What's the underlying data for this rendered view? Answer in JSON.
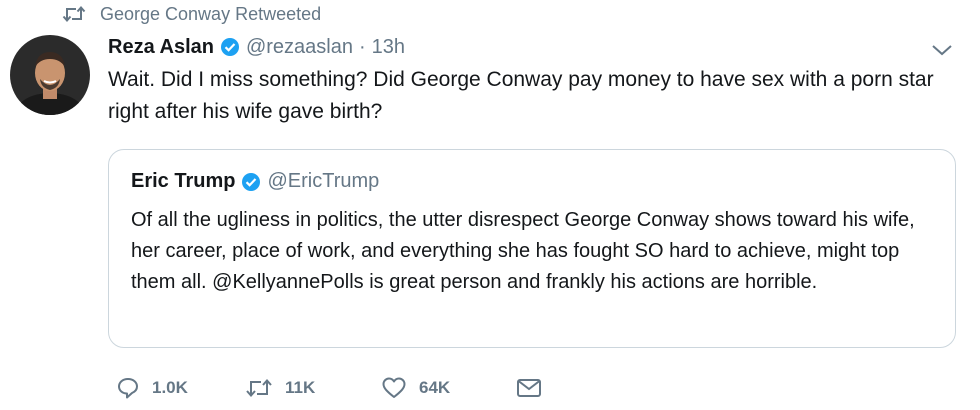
{
  "retweet_context": {
    "label": "George Conway Retweeted",
    "icon": "retweet-icon"
  },
  "tweet": {
    "author_name": "Reza Aslan",
    "verified_icon": "verified-badge-icon",
    "handle": "@rezaaslan",
    "separator": "·",
    "time": "13h",
    "text": "Wait. Did I miss something? Did George Conway pay money to have sex with a porn star right after his wife gave birth?",
    "menu_icon": "chevron-down-icon"
  },
  "quoted_tweet": {
    "author_name": "Eric Trump",
    "handle": "@EricTrump",
    "text": "Of all the ugliness in politics, the utter disrespect George Conway shows toward his wife, her career, place of work, and everything she has fought SO hard to achieve, might top them all. @KellyannePolls is great person and frankly his actions are horrible."
  },
  "actions": {
    "reply_count": "1.0K",
    "retweet_count": "11K",
    "like_count": "64K",
    "icons": [
      "reply-icon",
      "retweet-icon",
      "like-icon",
      "direct-message-icon"
    ]
  },
  "colors": {
    "verified": "#1da1f2",
    "secondary_text": "#657786",
    "border": "#ccd6dd",
    "primary_text": "#14171a"
  }
}
